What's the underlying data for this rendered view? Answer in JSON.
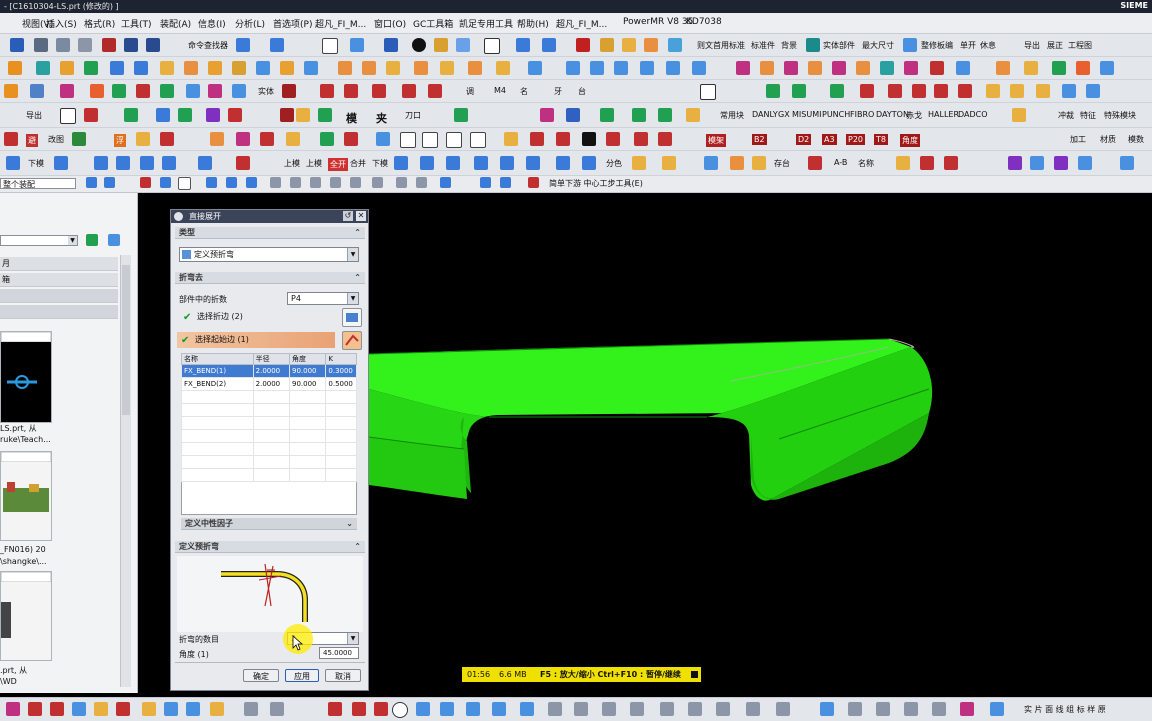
{
  "window": {
    "title": "- [C1610304-LS.prt  (修改的)  ]",
    "brand": "SIEME"
  },
  "menu": [
    "视图(V)",
    "插入(S)",
    "格式(R)",
    "工具(T)",
    "装配(A)",
    "信息(I)",
    "分析(L)",
    "首选项(P)",
    "超凡_FI_M...",
    "窗口(O)",
    "GC工具箱",
    "凯足专用工具",
    "帮助(H)",
    "超凡_FI_M...",
    "PowerMR V8 35",
    "KD7038"
  ],
  "toolbar": {
    "row1": [
      "命令查找器",
      "则文首用标准",
      "标准件",
      "背景",
      "实体部件",
      "最大尺寸",
      "整修板编",
      "单开",
      "休息",
      "导出",
      "展正",
      "工程图"
    ],
    "row3": [
      "导出",
      "实体",
      "模",
      "夹",
      "刀口",
      "调",
      "M4",
      "名",
      "牙",
      "台",
      "常用块",
      "DANLY",
      "GX",
      "MISUMI",
      "PUNCH",
      "FIBRO",
      "DAYTON",
      "赤戈",
      "HALLER",
      "DADCO",
      "冲裁",
      "特征",
      "特殊模块",
      "加工",
      "材质"
    ],
    "row4": [
      "避",
      "改图",
      "浮",
      "排版",
      "展开",
      "模架",
      "B2",
      "D2",
      "A3",
      "P20",
      "T8",
      "角度",
      "加工",
      "材质",
      "模数"
    ],
    "row5": [
      "下模",
      "上模",
      "上模",
      "下模",
      "全开",
      "合并",
      "分色",
      "A-B",
      "名称",
      "存台"
    ],
    "select_filter": "整个装配",
    "selbar_extra": "简单下游  中心工步工具(E)"
  },
  "navigator": {
    "rows": [
      "月",
      "箱"
    ],
    "captions": [
      "LS.prt, 从",
      "ruke\\Teach...",
      "_FN016) 20",
      "\\shangke\\...",
      ".prt, 从",
      "\\WD"
    ]
  },
  "dialog": {
    "title": "直接展开",
    "sect_type": "类型",
    "type_value": "定义预折弯",
    "sect_bend": "折弯去",
    "count_label": "部件中的折数",
    "count_value": "P4",
    "select_bend_face": "选择折边 (2)",
    "select_start_edge": "选择起始边 (1)",
    "table_headers": [
      "名称",
      "半径",
      "角度",
      "K"
    ],
    "table_rows": [
      [
        "FX_BEND(1)",
        "2.0000",
        "90.000",
        "0.3000"
      ],
      [
        "FX_BEND(2)",
        "2.0000",
        "90.000",
        "0.5000"
      ]
    ],
    "neutral_label": "定义中性因子",
    "sect_prebend": "定义预折弯",
    "bend_count_label": "折弯的数目",
    "bend_count_value": "2",
    "angle_label": "角度 (1)",
    "angle_value": "45.0000",
    "btn_ok": "确定",
    "btn_apply": "应用",
    "btn_cancel": "取消"
  },
  "status": {
    "time": "01:56",
    "size": "6.6 MB",
    "hint": "F5 : 放大/缩小 Ctrl+F10 : 暂停/继续"
  },
  "bottombar": {
    "right_text": "实  片  面  线  组  标  样  原"
  },
  "colors": {
    "part_green": "#2bea19",
    "viewport_bg": "#000000",
    "status_yellow": "#f0e000",
    "highlight": "#3e7bd1"
  }
}
